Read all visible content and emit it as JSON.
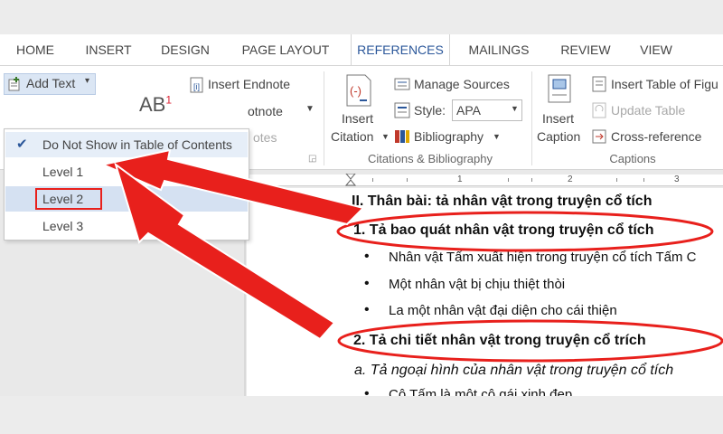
{
  "ribbon_tabs": [
    "HOME",
    "INSERT",
    "DESIGN",
    "PAGE LAYOUT",
    "REFERENCES",
    "MAILINGS",
    "REVIEW",
    "VIEW"
  ],
  "active_tab": "REFERENCES",
  "ribbon": {
    "add_text": "Add Text",
    "insert_endnote": "Insert Endnote",
    "next_footnote_partial": "otnote",
    "show_notes_partial": "otes",
    "insert_citation_line1": "Insert",
    "insert_citation_line2": "Citation",
    "manage_sources": "Manage Sources",
    "style_label": "Style:",
    "style_value": "APA",
    "bibliography": "Bibliography",
    "citations_group": "Citations & Bibliography",
    "insert_caption_line1": "Insert",
    "insert_caption_line2": "Caption",
    "insert_table_of_figures": "Insert Table of Figu",
    "update_table": "Update Table",
    "cross_reference": "Cross-reference",
    "captions_group": "Captions",
    "footnote_icon_text": "AB",
    "footnote_icon_sup": "1"
  },
  "dropdown": {
    "items": [
      "Do Not Show in Table of Contents",
      "Level 1",
      "Level 2",
      "Level 3"
    ],
    "checked_index": 0,
    "highlighted_index": 2
  },
  "ruler_numbers": [
    "1",
    "2",
    "3"
  ],
  "document": {
    "heading": "II.  Thân bài: tả nhân vật trong truyện cổ tích",
    "section1": "1. Tả bao quát nhân vật trong truyện cổ tích",
    "bullets": [
      "Nhân vật Tấm xuất hiện trong truyện cổ tích Tấm C",
      "Một nhân vật bị chịu thiệt thòi",
      "La một nhân vật đại diện cho cái thiện"
    ],
    "section2": "2. Tả chi tiết nhân vật trong truyện cổ trích",
    "italic_line": "a. Tả ngoại hình của nhân vật trong truyện cổ tích",
    "cut_line": "Cô Tấm là một cô gái xinh đẹp"
  },
  "colors": {
    "accent": "#2b579a",
    "annotation": "#e8201c",
    "highlight": "#d5e1f2"
  }
}
